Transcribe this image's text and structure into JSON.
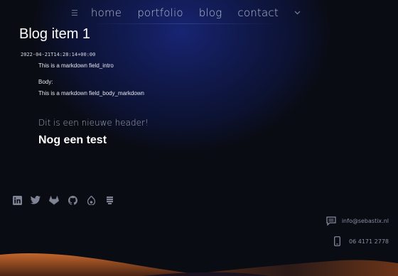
{
  "nav": {
    "menu_icon": "hamburger-icon",
    "items": [
      {
        "label": "home"
      },
      {
        "label": "portfolio"
      },
      {
        "label": "blog"
      },
      {
        "label": "contact"
      }
    ],
    "dropdown_icon": "chevron-down-icon"
  },
  "post": {
    "title": "Blog item 1",
    "date": "2022-04-21T14:28:14+00:00",
    "intro": "This is a markdown field_intro",
    "body_label": "Body:",
    "body": "This is a markdown field_body_markdown",
    "header_light": "Dit is een nieuwe header!",
    "header_bold": "Nog een test"
  },
  "footer": {
    "socials": [
      "linkedin-icon",
      "twitter-icon",
      "gitlab-icon",
      "github-icon",
      "drupal-icon",
      "stack-icon"
    ],
    "email": "info@sebastix.nl",
    "phone": "06 4171 2778",
    "email_icon": "message-icon",
    "phone_icon": "mobile-phone-icon"
  },
  "colors": {
    "background": "#0a0c14",
    "glow": "#172472",
    "accent_orange": "#c0602a"
  }
}
